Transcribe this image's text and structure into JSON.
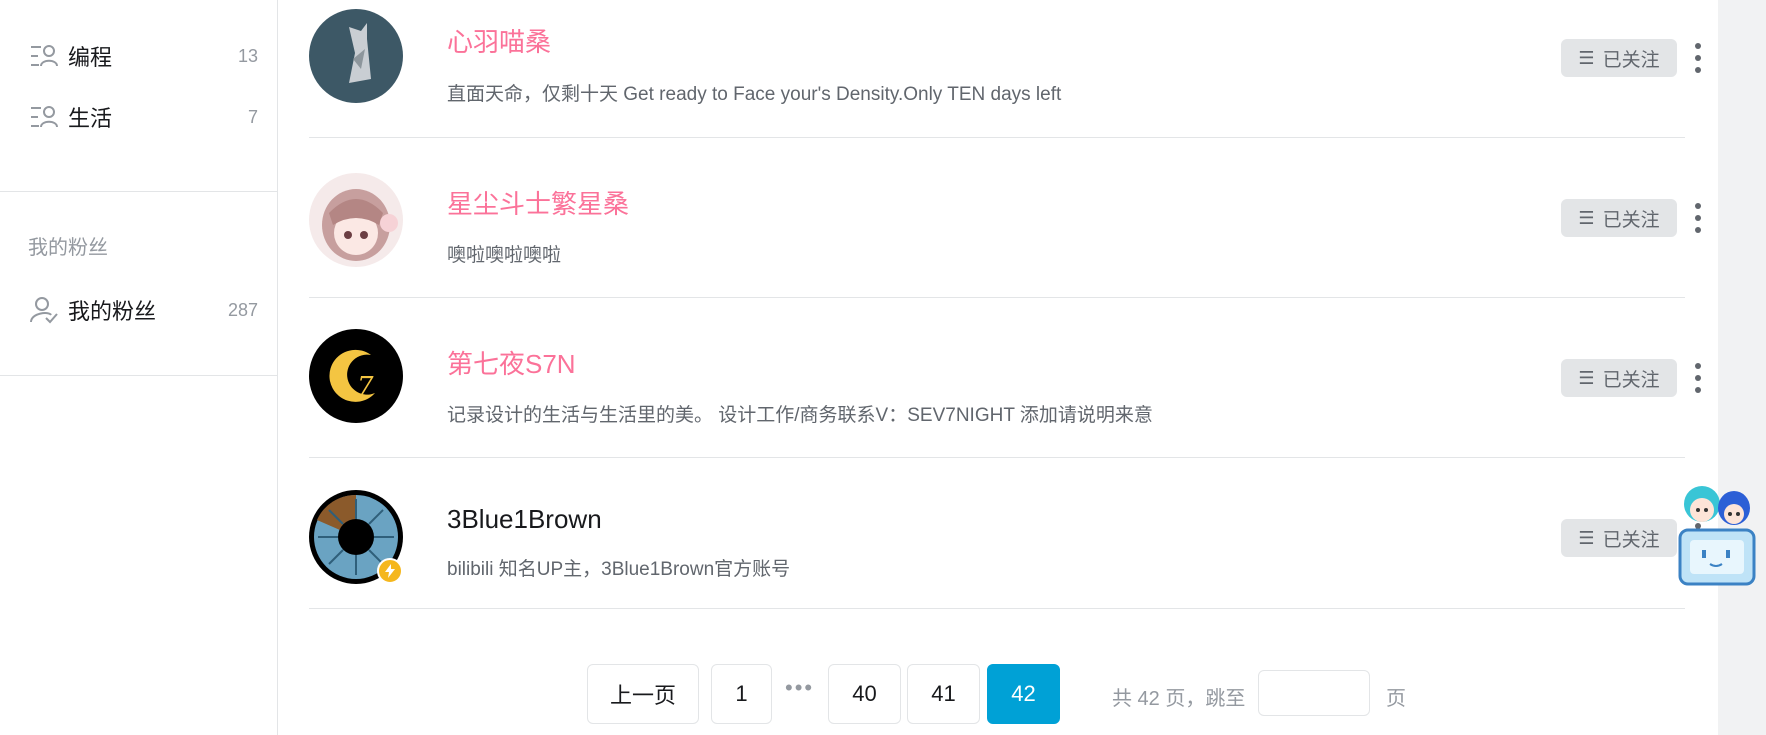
{
  "sidebar": {
    "groups": [
      {
        "label": "编程",
        "count": "13"
      },
      {
        "label": "生活",
        "count": "7"
      }
    ],
    "fans_section_title": "我的粉丝",
    "fans_item": {
      "label": "我的粉丝",
      "count": "287"
    }
  },
  "users": [
    {
      "name": "心羽喵桑",
      "sign": "直面天命，仅剩十天 Get ready to Face your's Density.Only TEN days left",
      "follow_label": "已关注",
      "name_color": "#fb7299"
    },
    {
      "name": "星尘斗士繁星桑",
      "sign": "噢啦噢啦噢啦",
      "follow_label": "已关注",
      "name_color": "#fb7299"
    },
    {
      "name": "第七夜S7N",
      "sign": "记录设计的生活与生活里的美。 设计工作/商务联系V：SEV7NIGHT 添加请说明来意",
      "follow_label": "已关注",
      "name_color": "#fb7299"
    },
    {
      "name": "3Blue1Brown",
      "sign": "bilibili 知名UP主，3Blue1Brown官方账号",
      "follow_label": "已关注",
      "name_color": "#18191c"
    }
  ],
  "pagination": {
    "prev_label": "上一页",
    "pages": [
      "1",
      "40",
      "41",
      "42"
    ],
    "ellipsis": "•••",
    "current": "42",
    "total_text": "共 42 页，跳至",
    "suffix": "页",
    "input_value": ""
  },
  "colors": {
    "accent": "#00a1d6",
    "vip_name": "#fb7299"
  },
  "icons": {
    "group": "group-list-icon",
    "fans": "fans-check-icon",
    "more": "more-vertical-icon",
    "follow_menu": "menu-lines-icon",
    "verified": "lightning-badge-icon",
    "mascot": "mascot-icon"
  }
}
